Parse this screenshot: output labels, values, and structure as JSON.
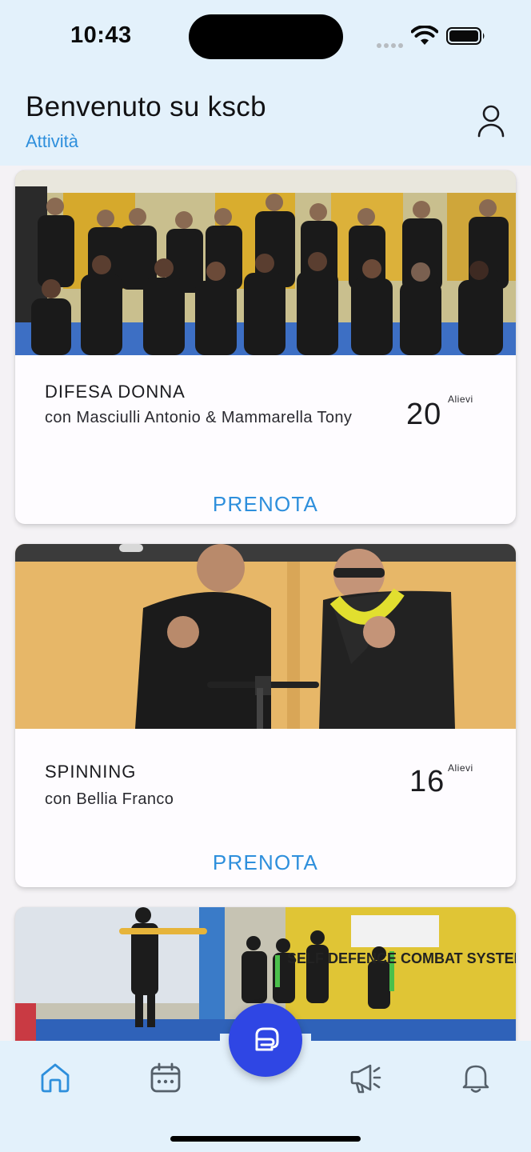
{
  "status_bar": {
    "time": "10:43"
  },
  "header": {
    "title": "Benvenuto su kscb",
    "subtitle": "Attività"
  },
  "activities": [
    {
      "name": "DIFESA DONNA",
      "instructor": "con Masciulli Antonio & Mammarella Tony",
      "count": "20",
      "count_unit": "Alievi",
      "action": "PRENOTA",
      "image": "group-photo-team"
    },
    {
      "name": "SPINNING",
      "instructor": "con Bellia Franco",
      "count": "16",
      "count_unit": "Alievi",
      "action": "PRENOTA",
      "image": "two-men-spinning-bike"
    },
    {
      "name": "",
      "instructor": "",
      "count": "",
      "count_unit": "",
      "action": "",
      "image": "training-gym-class"
    }
  ],
  "bottom_nav": {
    "items": [
      {
        "id": "home",
        "icon": "home-icon",
        "active": true
      },
      {
        "id": "calendar",
        "icon": "calendar-icon",
        "active": false
      },
      {
        "id": "center",
        "icon": "boxing-glove-icon",
        "active": false
      },
      {
        "id": "announcements",
        "icon": "megaphone-icon",
        "active": false
      },
      {
        "id": "notifications",
        "icon": "bell-icon",
        "active": false
      }
    ]
  },
  "colors": {
    "accent": "#2e8fdc",
    "fab": "#2f46e4",
    "header_bg": "#e3f1fb",
    "page_bg": "#f4f2f5",
    "card_bg": "#fefcff"
  }
}
